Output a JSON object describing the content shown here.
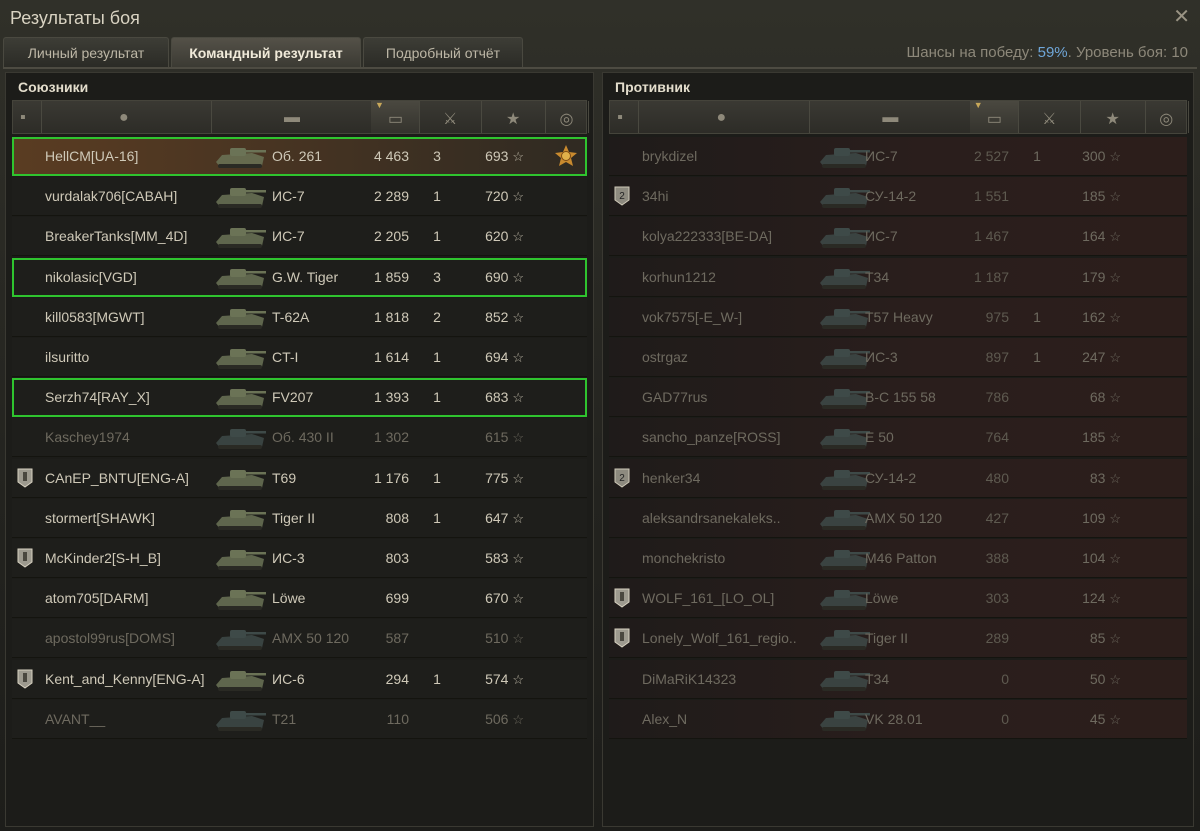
{
  "window": {
    "title": "Результаты боя",
    "close_glyph": "✕"
  },
  "tabs": [
    {
      "label": "Личный результат",
      "active": false
    },
    {
      "label": "Командный результат",
      "active": true
    },
    {
      "label": "Подробный отчёт",
      "active": false
    }
  ],
  "chance": {
    "label": "Шансы на победу: ",
    "value": "59%",
    "rest": ". Уровень боя: 10"
  },
  "colors": {
    "squad_outline": "#2fc42f",
    "chance_value": "#6fa6d8",
    "self_row": "#5a3c22"
  },
  "allies": {
    "title": "Союзники",
    "rows": [
      {
        "name": "HellCM[UA-16]",
        "tank": "Об. 261",
        "damage": "4 463",
        "kills": "3",
        "xp": "693",
        "status": "self",
        "squad": true,
        "medal": "order-medal-icon"
      },
      {
        "name": "vurdalak706[CABAH]",
        "tank": "ИС-7",
        "damage": "2 289",
        "kills": "1",
        "xp": "720",
        "status": "alive"
      },
      {
        "name": "BreakerTanks[MM_4D]",
        "tank": "ИС-7",
        "damage": "2 205",
        "kills": "1",
        "xp": "620",
        "status": "alive"
      },
      {
        "name": "nikolasic[VGD]",
        "tank": "G.W. Tiger",
        "damage": "1 859",
        "kills": "3",
        "xp": "690",
        "status": "alive",
        "squad": true
      },
      {
        "name": "kill0583[MGWT]",
        "tank": "T-62A",
        "damage": "1 818",
        "kills": "2",
        "xp": "852",
        "status": "alive"
      },
      {
        "name": "ilsuritto",
        "tank": "CT-I",
        "damage": "1 614",
        "kills": "1",
        "xp": "694",
        "status": "alive"
      },
      {
        "name": "Serzh74[RAY_X]",
        "tank": "FV207",
        "damage": "1 393",
        "kills": "1",
        "xp": "683",
        "status": "alive",
        "squad": true
      },
      {
        "name": "Kaschey1974",
        "tank": "Об. 430 II",
        "damage": "1 302",
        "kills": "",
        "xp": "615",
        "status": "dead"
      },
      {
        "name": "CAnEP_BNTU[ENG-A]",
        "tank": "T69",
        "damage": "1 176",
        "kills": "1",
        "xp": "775",
        "status": "alive",
        "badge": "clan-shield-icon"
      },
      {
        "name": "stormert[SHAWK]",
        "tank": "Tiger II",
        "damage": "808",
        "kills": "1",
        "xp": "647",
        "status": "alive"
      },
      {
        "name": "McKinder2[S-H_B]",
        "tank": "ИС-3",
        "damage": "803",
        "kills": "",
        "xp": "583",
        "status": "alive",
        "badge": "clan-shield-icon"
      },
      {
        "name": "atom705[DARM]",
        "tank": "Löwe",
        "damage": "699",
        "kills": "",
        "xp": "670",
        "status": "alive"
      },
      {
        "name": "apostol99rus[DOMS]",
        "tank": "AMX 50 120",
        "damage": "587",
        "kills": "",
        "xp": "510",
        "status": "dead"
      },
      {
        "name": "Kent_and_Kenny[ENG-A]",
        "tank": "ИС-6",
        "damage": "294",
        "kills": "1",
        "xp": "574",
        "status": "alive",
        "badge": "clan-shield-icon"
      },
      {
        "name": "AVANT__",
        "tank": "T21",
        "damage": "110",
        "kills": "",
        "xp": "506",
        "status": "dead"
      }
    ]
  },
  "enemies": {
    "title": "Противник",
    "rows": [
      {
        "name": "brykdizel",
        "tank": "ИС-7",
        "damage": "2 527",
        "kills": "1",
        "xp": "300",
        "status": "dead"
      },
      {
        "name": "34hi",
        "tank": "СУ-14-2",
        "damage": "1 551",
        "kills": "",
        "xp": "185",
        "status": "dead",
        "badge": "platoon-2-icon"
      },
      {
        "name": "kolya222333[BE-DA]",
        "tank": "ИС-7",
        "damage": "1 467",
        "kills": "",
        "xp": "164",
        "status": "dead"
      },
      {
        "name": "korhun1212",
        "tank": "T34",
        "damage": "1 187",
        "kills": "",
        "xp": "179",
        "status": "dead"
      },
      {
        "name": "vok7575[-E_W-]",
        "tank": "T57 Heavy",
        "damage": "975",
        "kills": "1",
        "xp": "162",
        "status": "dead"
      },
      {
        "name": "ostrgaz",
        "tank": "ИС-3",
        "damage": "897",
        "kills": "1",
        "xp": "247",
        "status": "dead"
      },
      {
        "name": "GAD77rus",
        "tank": "B-C 155 58",
        "damage": "786",
        "kills": "",
        "xp": "68",
        "status": "dead"
      },
      {
        "name": "sancho_panze[ROSS]",
        "tank": "E 50",
        "damage": "764",
        "kills": "",
        "xp": "185",
        "status": "dead"
      },
      {
        "name": "henker34",
        "tank": "СУ-14-2",
        "damage": "480",
        "kills": "",
        "xp": "83",
        "status": "dead",
        "badge": "platoon-2-icon"
      },
      {
        "name": "aleksandrsanekaleks..",
        "tank": "AMX 50 120",
        "damage": "427",
        "kills": "",
        "xp": "109",
        "status": "dead"
      },
      {
        "name": "monchekristo",
        "tank": "M46 Patton",
        "damage": "388",
        "kills": "",
        "xp": "104",
        "status": "dead"
      },
      {
        "name": "WOLF_161_[LO_OL]",
        "tank": "Löwe",
        "damage": "303",
        "kills": "",
        "xp": "124",
        "status": "dead",
        "badge": "clan-shield-icon"
      },
      {
        "name": "Lonely_Wolf_161_regio..",
        "tank": "Tiger II",
        "damage": "289",
        "kills": "",
        "xp": "85",
        "status": "dead",
        "badge": "clan-shield-icon"
      },
      {
        "name": "DiMaRiK14323",
        "tank": "T34",
        "damage": "0",
        "kills": "",
        "xp": "50",
        "status": "dead"
      },
      {
        "name": "Alex_N",
        "tank": "VK 28.01",
        "damage": "0",
        "kills": "",
        "xp": "45",
        "status": "dead"
      }
    ]
  },
  "column_icons": [
    "badge-column-icon",
    "player-column-icon",
    "tank-column-icon",
    "damage-column-icon",
    "kills-column-icon",
    "xp-star-column-icon",
    "medal-column-icon"
  ],
  "star_glyph": "☆"
}
